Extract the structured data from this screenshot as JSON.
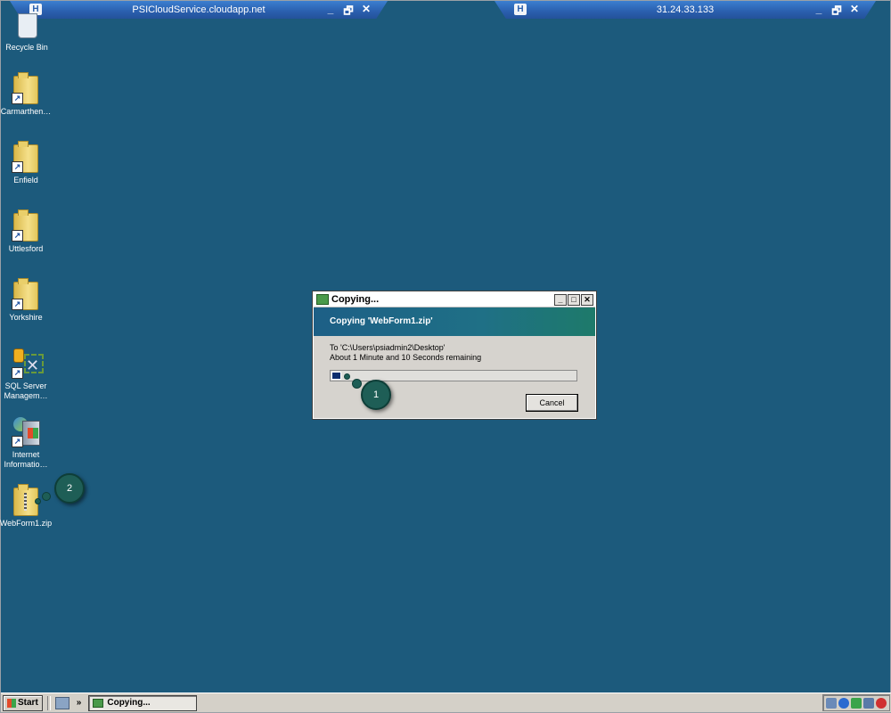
{
  "remote_bars": [
    {
      "host": "PSICloudService.cloudapp.net"
    },
    {
      "host": "31.24.33.133"
    }
  ],
  "remote_controls": {
    "minimize": "_",
    "restore": "🗗",
    "close": "✕",
    "pin": "H"
  },
  "desktop_icons": [
    {
      "label": "Recycle Bin",
      "icon": "recycle-bin-icon"
    },
    {
      "label": "Carmarthen…",
      "icon": "folder-shortcut-icon"
    },
    {
      "label": "Enfield",
      "icon": "folder-shortcut-icon"
    },
    {
      "label": "Uttlesford",
      "icon": "folder-shortcut-icon"
    },
    {
      "label": "Yorkshire",
      "icon": "folder-shortcut-icon"
    },
    {
      "label": "SQL Server Managem…",
      "icon": "sql-server-icon"
    },
    {
      "label": "Internet Informatio…",
      "icon": "iis-manager-icon"
    },
    {
      "label": "WebForm1.zip",
      "icon": "zip-folder-icon"
    }
  ],
  "callouts": [
    "1",
    "2"
  ],
  "dialog": {
    "title": "Copying...",
    "heading": "Copying 'WebForm1.zip'",
    "destination": "To 'C:\\Users\\psiadmin2\\Desktop'",
    "time_remaining": "About 1 Minute and 10 Seconds remaining",
    "progress": 0.04,
    "cancel_label": "Cancel"
  },
  "taskbar": {
    "start_label": "Start",
    "overflow": "»",
    "task_label": "Copying...",
    "tray_icons": [
      "network-icon",
      "server-manager-icon",
      "refresh-icon",
      "volume-icon",
      "security-alert-icon"
    ]
  },
  "colors": {
    "desktop": "#1c5a7c",
    "banner_start": "#1d5f86",
    "banner_end": "#1e7a6a",
    "callout": "#1e5e56",
    "progress_fill": "#0d2d6e"
  }
}
